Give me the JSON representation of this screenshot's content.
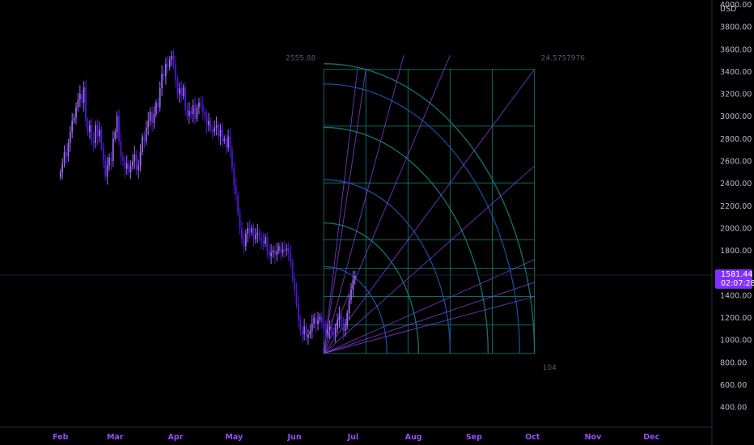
{
  "chart_data": {
    "type": "candlestick",
    "currency_label": "USD",
    "y_ticks": [
      400,
      600,
      800,
      1000,
      1200,
      1400,
      1600,
      1800,
      2000,
      2200,
      2400,
      2600,
      2800,
      3000,
      3200,
      3400,
      3600,
      3800,
      4000
    ],
    "y_tick_labels": [
      "400.00",
      "600.00",
      "800.00",
      "1000.00",
      "1200.00",
      "1400.00",
      "1600.00",
      "1800.00",
      "2000.00",
      "2200.00",
      "2400.00",
      "2600.00",
      "2800.00",
      "3000.00",
      "3200.00",
      "3400.00",
      "3600.00",
      "3800.00",
      "4000.00"
    ],
    "ylim": [
      220,
      4040
    ],
    "x_months": [
      "Feb",
      "Mar",
      "Apr",
      "May",
      "Jun",
      "Jul",
      "Aug",
      "Sep",
      "Oct",
      "Nov",
      "Dec"
    ],
    "x_range_days": [
      "Jan 01",
      "Dec 31"
    ],
    "candles": {
      "start_day": 32,
      "close": [
        2500,
        2580,
        2680,
        2640,
        2760,
        2860,
        2960,
        2990,
        3080,
        3150,
        3200,
        3120,
        3260,
        2960,
        2860,
        2920,
        2780,
        2760,
        2920,
        2820,
        2880,
        2720,
        2600,
        2460,
        2560,
        2630,
        2600,
        2800,
        2860,
        3000,
        2780,
        2640,
        2600,
        2530,
        2580,
        2500,
        2560,
        2600,
        2660,
        2520,
        2560,
        2680,
        2820,
        2780,
        2900,
        2960,
        3040,
        2940,
        3020,
        3120,
        3080,
        3250,
        3380,
        3360,
        3470,
        3440,
        3510,
        3540,
        3460,
        3330,
        3200,
        3250,
        3180,
        3260,
        3060,
        3000,
        3050,
        3020,
        3100,
        2980,
        3080,
        3120,
        3100,
        3040,
        3000,
        2920,
        2960,
        2880,
        2860,
        2900,
        2920,
        2820,
        2880,
        2780,
        2800,
        2720,
        2820,
        2700,
        2540,
        2380,
        2300,
        2140,
        2000,
        1900,
        1840,
        1950,
        2000,
        1960,
        2000,
        1900,
        1940,
        1960,
        1920,
        1890,
        1860,
        1920,
        1800,
        1750,
        1780,
        1800,
        1760,
        1800,
        1840,
        1780,
        1810,
        1800,
        1820,
        1780,
        1700,
        1550,
        1450,
        1320,
        1180,
        1080,
        1050,
        1120,
        1020,
        1050,
        1080,
        1150,
        1200,
        1140,
        1180,
        1210,
        1160,
        1100,
        1060,
        1090,
        1120,
        1080,
        1040,
        1100,
        1180,
        1220,
        1150,
        1080,
        1120,
        1240,
        1360,
        1450,
        1540,
        1581
      ]
    },
    "current_price": "1581.44",
    "countdown": "02:07:28",
    "gann_box": {
      "start_day": 167,
      "end_day": 275,
      "price_low": 880,
      "price_high": 3420,
      "label_top_left": "2555.88",
      "label_top_right": "24.5757976",
      "label_bottom_right": "104"
    },
    "colors": {
      "up": "#a06af5",
      "down": "#4e18d8",
      "axis_month": "#9a4bff",
      "price_badge": "#8030ff",
      "gann_grid": "#137a72",
      "gann_fan": "#8a40e8",
      "gann_arc": "#1a4fa8"
    }
  }
}
